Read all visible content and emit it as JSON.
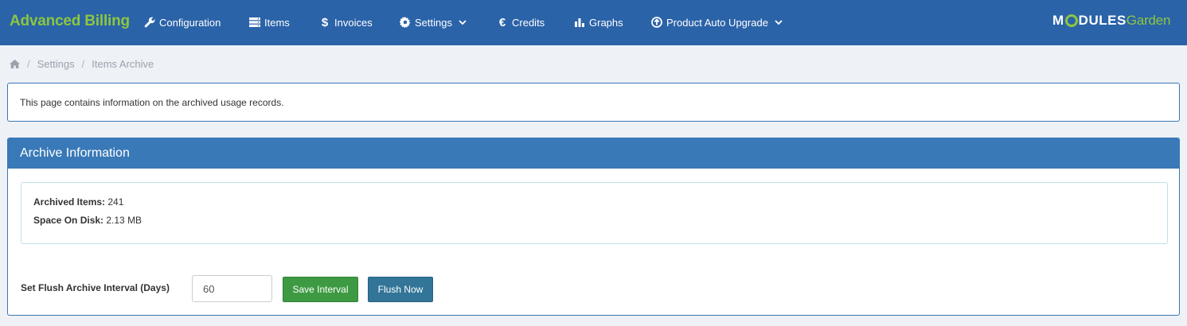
{
  "app": {
    "title": "Advanced Billing"
  },
  "nav": {
    "items": [
      {
        "label": "Configuration",
        "icon": "wrench-icon"
      },
      {
        "label": "Items",
        "icon": "server-icon"
      },
      {
        "label": "Invoices",
        "icon": "dollar-icon"
      },
      {
        "label": "Settings",
        "icon": "gear-icon",
        "dropdown": true
      },
      {
        "label": "Credits",
        "icon": "euro-icon"
      },
      {
        "label": "Graphs",
        "icon": "bar-chart-icon"
      },
      {
        "label": "Product Auto Upgrade",
        "icon": "arrow-circle-up-icon",
        "dropdown": true
      }
    ]
  },
  "logo": {
    "part1": "M",
    "part2": "DULES",
    "part3": "Garden"
  },
  "breadcrumb": {
    "items": [
      "Settings",
      "Items Archive"
    ],
    "home_icon": "home-icon"
  },
  "info": {
    "text": "This page contains information on the archived usage records."
  },
  "panel": {
    "title": "Archive Information",
    "archived_items_label": "Archived Items:",
    "archived_items_value": "241",
    "space_label": "Space On Disk:",
    "space_value": "2.13 MB",
    "flush_label": "Set Flush Archive Interval (Days)",
    "flush_value": "60",
    "save_button": "Save Interval",
    "flush_button": "Flush Now"
  },
  "colors": {
    "topbar": "#2b63a8",
    "brand": "#8cc63f",
    "panel_header": "#3a79b8",
    "save_button": "#3d9a42",
    "flush_button": "#337599"
  }
}
